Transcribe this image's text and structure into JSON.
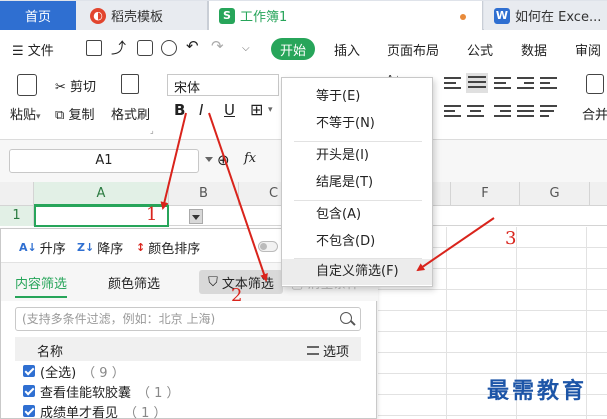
{
  "tabs": {
    "home": "首页",
    "template": "稻壳模板",
    "workbook": "工作簿1",
    "doc": "如何在 Exce..."
  },
  "menu": {
    "file": "文件",
    "start": "开始",
    "insert": "插入",
    "page_layout": "页面布局",
    "formula": "公式",
    "data": "数据",
    "review": "审阅"
  },
  "ribbon": {
    "paste": "粘贴",
    "cut": "剪切",
    "copy": "复制",
    "format_painter": "格式刷",
    "font": "宋体",
    "bold": "B",
    "italic": "I",
    "underline": "U",
    "merge": "合并"
  },
  "formula_bar": {
    "name_box": "A1",
    "fx": "fx"
  },
  "grid": {
    "columns": [
      "A",
      "B",
      "C",
      "F",
      "G"
    ],
    "row": "1"
  },
  "filter_panel": {
    "sort_asc": "升序",
    "sort_desc": "降序",
    "sort_color": "颜色排序",
    "tab_content": "内容筛选",
    "tab_color": "颜色筛选",
    "text_filter": "文本筛选",
    "clear": "清空条件",
    "search_placeholder": "(支持多条件过滤，例如：北京 上海)",
    "list_header": "名称",
    "options": "选项",
    "items": [
      {
        "label": "(全选)",
        "count": "（ 9 ）"
      },
      {
        "label": "查看佳能软胶囊",
        "count": "（ 1 ）"
      },
      {
        "label": "成绩单才看见",
        "count": "（ 1 ）"
      }
    ]
  },
  "dropdown": {
    "items": [
      "等于(E)",
      "不等于(N)",
      "开头是(I)",
      "结尾是(T)",
      "包含(A)",
      "不包含(D)",
      "自定义筛选(F)"
    ]
  },
  "annotations": {
    "step1": "1",
    "step2": "2",
    "step3": "3",
    "watermark": "最需教育"
  },
  "colors": {
    "accent_green": "#27a55a",
    "tab_blue": "#2f6fd1",
    "arrow_red": "#d9241c",
    "watermark_blue": "#1d55a7"
  }
}
